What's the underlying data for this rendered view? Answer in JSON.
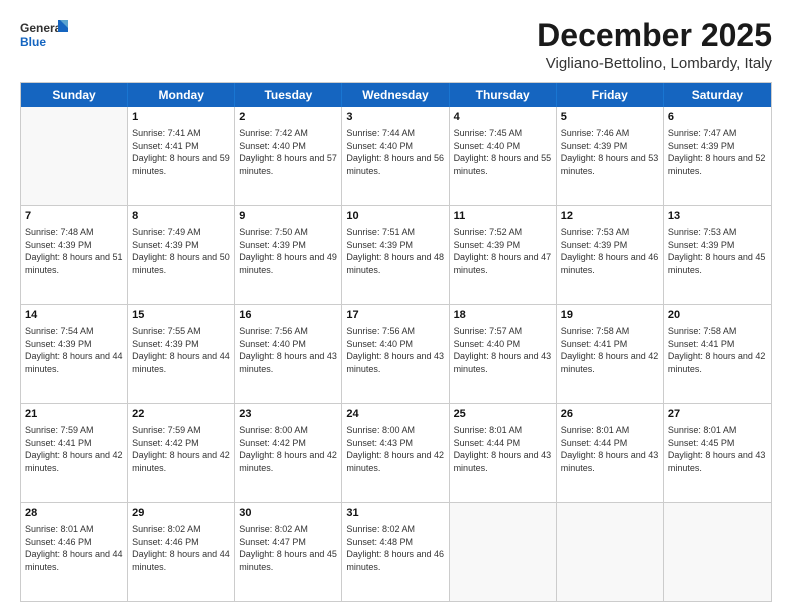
{
  "logo": {
    "line1": "General",
    "line2": "Blue"
  },
  "title": "December 2025",
  "location": "Vigliano-Bettolino, Lombardy, Italy",
  "days": [
    "Sunday",
    "Monday",
    "Tuesday",
    "Wednesday",
    "Thursday",
    "Friday",
    "Saturday"
  ],
  "weeks": [
    [
      {
        "day": "",
        "sunrise": "",
        "sunset": "",
        "daylight": "",
        "empty": true
      },
      {
        "day": "1",
        "sunrise": "Sunrise: 7:41 AM",
        "sunset": "Sunset: 4:41 PM",
        "daylight": "Daylight: 8 hours and 59 minutes."
      },
      {
        "day": "2",
        "sunrise": "Sunrise: 7:42 AM",
        "sunset": "Sunset: 4:40 PM",
        "daylight": "Daylight: 8 hours and 57 minutes."
      },
      {
        "day": "3",
        "sunrise": "Sunrise: 7:44 AM",
        "sunset": "Sunset: 4:40 PM",
        "daylight": "Daylight: 8 hours and 56 minutes."
      },
      {
        "day": "4",
        "sunrise": "Sunrise: 7:45 AM",
        "sunset": "Sunset: 4:40 PM",
        "daylight": "Daylight: 8 hours and 55 minutes."
      },
      {
        "day": "5",
        "sunrise": "Sunrise: 7:46 AM",
        "sunset": "Sunset: 4:39 PM",
        "daylight": "Daylight: 8 hours and 53 minutes."
      },
      {
        "day": "6",
        "sunrise": "Sunrise: 7:47 AM",
        "sunset": "Sunset: 4:39 PM",
        "daylight": "Daylight: 8 hours and 52 minutes."
      }
    ],
    [
      {
        "day": "7",
        "sunrise": "Sunrise: 7:48 AM",
        "sunset": "Sunset: 4:39 PM",
        "daylight": "Daylight: 8 hours and 51 minutes."
      },
      {
        "day": "8",
        "sunrise": "Sunrise: 7:49 AM",
        "sunset": "Sunset: 4:39 PM",
        "daylight": "Daylight: 8 hours and 50 minutes."
      },
      {
        "day": "9",
        "sunrise": "Sunrise: 7:50 AM",
        "sunset": "Sunset: 4:39 PM",
        "daylight": "Daylight: 8 hours and 49 minutes."
      },
      {
        "day": "10",
        "sunrise": "Sunrise: 7:51 AM",
        "sunset": "Sunset: 4:39 PM",
        "daylight": "Daylight: 8 hours and 48 minutes."
      },
      {
        "day": "11",
        "sunrise": "Sunrise: 7:52 AM",
        "sunset": "Sunset: 4:39 PM",
        "daylight": "Daylight: 8 hours and 47 minutes."
      },
      {
        "day": "12",
        "sunrise": "Sunrise: 7:53 AM",
        "sunset": "Sunset: 4:39 PM",
        "daylight": "Daylight: 8 hours and 46 minutes."
      },
      {
        "day": "13",
        "sunrise": "Sunrise: 7:53 AM",
        "sunset": "Sunset: 4:39 PM",
        "daylight": "Daylight: 8 hours and 45 minutes."
      }
    ],
    [
      {
        "day": "14",
        "sunrise": "Sunrise: 7:54 AM",
        "sunset": "Sunset: 4:39 PM",
        "daylight": "Daylight: 8 hours and 44 minutes."
      },
      {
        "day": "15",
        "sunrise": "Sunrise: 7:55 AM",
        "sunset": "Sunset: 4:39 PM",
        "daylight": "Daylight: 8 hours and 44 minutes."
      },
      {
        "day": "16",
        "sunrise": "Sunrise: 7:56 AM",
        "sunset": "Sunset: 4:40 PM",
        "daylight": "Daylight: 8 hours and 43 minutes."
      },
      {
        "day": "17",
        "sunrise": "Sunrise: 7:56 AM",
        "sunset": "Sunset: 4:40 PM",
        "daylight": "Daylight: 8 hours and 43 minutes."
      },
      {
        "day": "18",
        "sunrise": "Sunrise: 7:57 AM",
        "sunset": "Sunset: 4:40 PM",
        "daylight": "Daylight: 8 hours and 43 minutes."
      },
      {
        "day": "19",
        "sunrise": "Sunrise: 7:58 AM",
        "sunset": "Sunset: 4:41 PM",
        "daylight": "Daylight: 8 hours and 42 minutes."
      },
      {
        "day": "20",
        "sunrise": "Sunrise: 7:58 AM",
        "sunset": "Sunset: 4:41 PM",
        "daylight": "Daylight: 8 hours and 42 minutes."
      }
    ],
    [
      {
        "day": "21",
        "sunrise": "Sunrise: 7:59 AM",
        "sunset": "Sunset: 4:41 PM",
        "daylight": "Daylight: 8 hours and 42 minutes."
      },
      {
        "day": "22",
        "sunrise": "Sunrise: 7:59 AM",
        "sunset": "Sunset: 4:42 PM",
        "daylight": "Daylight: 8 hours and 42 minutes."
      },
      {
        "day": "23",
        "sunrise": "Sunrise: 8:00 AM",
        "sunset": "Sunset: 4:42 PM",
        "daylight": "Daylight: 8 hours and 42 minutes."
      },
      {
        "day": "24",
        "sunrise": "Sunrise: 8:00 AM",
        "sunset": "Sunset: 4:43 PM",
        "daylight": "Daylight: 8 hours and 42 minutes."
      },
      {
        "day": "25",
        "sunrise": "Sunrise: 8:01 AM",
        "sunset": "Sunset: 4:44 PM",
        "daylight": "Daylight: 8 hours and 43 minutes."
      },
      {
        "day": "26",
        "sunrise": "Sunrise: 8:01 AM",
        "sunset": "Sunset: 4:44 PM",
        "daylight": "Daylight: 8 hours and 43 minutes."
      },
      {
        "day": "27",
        "sunrise": "Sunrise: 8:01 AM",
        "sunset": "Sunset: 4:45 PM",
        "daylight": "Daylight: 8 hours and 43 minutes."
      }
    ],
    [
      {
        "day": "28",
        "sunrise": "Sunrise: 8:01 AM",
        "sunset": "Sunset: 4:46 PM",
        "daylight": "Daylight: 8 hours and 44 minutes."
      },
      {
        "day": "29",
        "sunrise": "Sunrise: 8:02 AM",
        "sunset": "Sunset: 4:46 PM",
        "daylight": "Daylight: 8 hours and 44 minutes."
      },
      {
        "day": "30",
        "sunrise": "Sunrise: 8:02 AM",
        "sunset": "Sunset: 4:47 PM",
        "daylight": "Daylight: 8 hours and 45 minutes."
      },
      {
        "day": "31",
        "sunrise": "Sunrise: 8:02 AM",
        "sunset": "Sunset: 4:48 PM",
        "daylight": "Daylight: 8 hours and 46 minutes."
      },
      {
        "day": "",
        "sunrise": "",
        "sunset": "",
        "daylight": "",
        "empty": true
      },
      {
        "day": "",
        "sunrise": "",
        "sunset": "",
        "daylight": "",
        "empty": true
      },
      {
        "day": "",
        "sunrise": "",
        "sunset": "",
        "daylight": "",
        "empty": true
      }
    ]
  ]
}
